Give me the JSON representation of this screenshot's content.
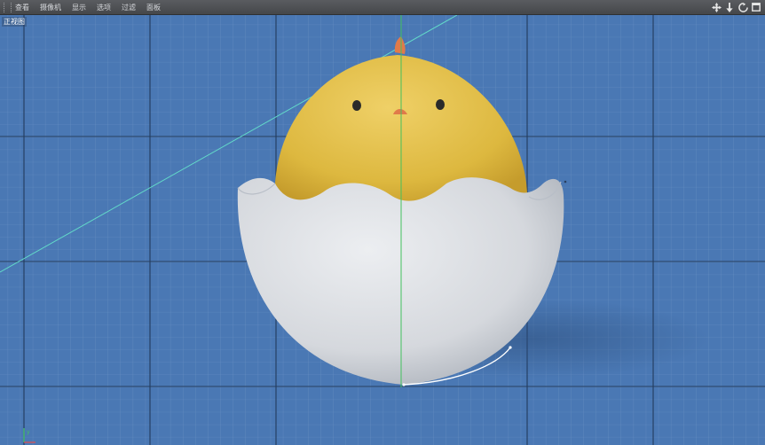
{
  "menu": {
    "items": [
      "查看",
      "摄像机",
      "显示",
      "选项",
      "过滤",
      "面板"
    ]
  },
  "nav_icons": [
    "move-icon",
    "pan-down-icon",
    "rotate-icon",
    "maximize-icon"
  ],
  "viewport": {
    "label": "正视图",
    "background_color": "#4a78b4",
    "grid_minor_color": "#5f88bf",
    "grid_major_color": "#1f3552",
    "guide_line_color": "#5fd6c8",
    "axis_line_color": "#3fbf5a"
  },
  "scene": {
    "chick_color": "#e5c24a",
    "shell_color": "#d8dbe0",
    "beak_color": "#e07a4a",
    "eye_color": "#2a2a2a"
  }
}
